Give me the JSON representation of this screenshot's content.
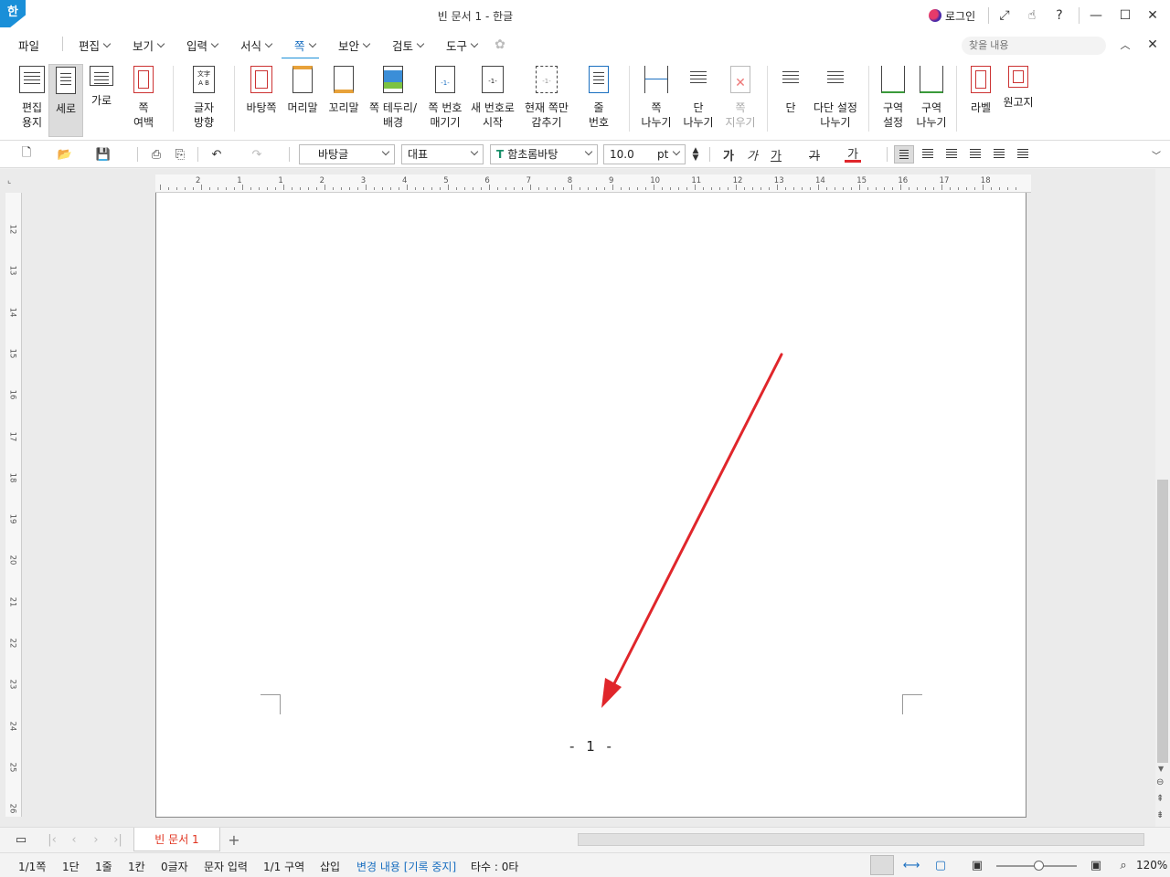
{
  "titlebar": {
    "app_logo": "한",
    "title": "빈 문서 1 - 한글",
    "login": "로그인"
  },
  "menu": {
    "file": "파일",
    "items": [
      "편집",
      "보기",
      "입력",
      "서식",
      "쪽",
      "보안",
      "검토",
      "도구"
    ],
    "active": "쪽",
    "search_placeholder": "찾을 내용"
  },
  "ribbon": {
    "buttons": [
      {
        "label": "편집\n용지"
      },
      {
        "label": "세로"
      },
      {
        "label": "가로"
      },
      {
        "label": "쪽\n여백"
      },
      {
        "label": "글자\n방향"
      },
      {
        "label": "바탕쪽"
      },
      {
        "label": "머리말"
      },
      {
        "label": "꼬리말"
      },
      {
        "label": "쪽 테두리/\n배경"
      },
      {
        "label": "쪽 번호\n매기기"
      },
      {
        "label": "새 번호로\n시작"
      },
      {
        "label": "현재 쪽만\n감추기"
      },
      {
        "label": "줄\n번호"
      },
      {
        "label": "쪽\n나누기"
      },
      {
        "label": "단\n나누기"
      },
      {
        "label": "쪽\n지우기"
      },
      {
        "label": "단"
      },
      {
        "label": "다단 설정\n나누기"
      },
      {
        "label": "구역\n설정"
      },
      {
        "label": "구역\n나누기"
      },
      {
        "label": "라벨"
      },
      {
        "label": "원고지"
      }
    ],
    "icon_text": {
      "page_num_icon": "-1-",
      "new_num_icon": "-1-",
      "hide_icon": "-1-",
      "new_num_small": "-3-",
      "hide_small": "-3-",
      "line_num_a": "1",
      "line_num_b": "2",
      "line_num_c": "3",
      "text_dir": "文字\nA B"
    }
  },
  "format": {
    "style": "바탕글",
    "lang": "대표",
    "font": "함초롬바탕",
    "font_icon": "T",
    "size": "10.0",
    "unit": "pt",
    "bold_glyph": "가",
    "italic_glyph": "가",
    "underline_glyph": "가",
    "strike_glyph": "가",
    "color_glyph": "가"
  },
  "ruler": {
    "h_numbers": [
      "2",
      "1",
      "1",
      "2",
      "3",
      "4",
      "5",
      "6",
      "7",
      "8",
      "9",
      "10",
      "11",
      "12",
      "13",
      "14",
      "15",
      "16",
      "17",
      "18"
    ],
    "v_numbers": [
      "12",
      "13",
      "14",
      "15",
      "16",
      "17",
      "18",
      "19",
      "20",
      "21",
      "22",
      "23",
      "24",
      "25",
      "26"
    ]
  },
  "page": {
    "page_number_text": "- 1 -",
    "annotation_color": "#e0262b"
  },
  "tabs": {
    "doc_tab": "빈 문서 1",
    "add_glyph": "+"
  },
  "status": {
    "page": "1/1쪽",
    "column": "1단",
    "line": "1줄",
    "cell": "1칸",
    "chars": "0글자",
    "input_mode": "문자 입력",
    "section": "1/1 구역",
    "insert": "삽입",
    "track": "변경 내용 [기록 중지]",
    "keystrokes": "타수 : 0타",
    "zoom": "120%"
  },
  "colors": {
    "accent": "#1a8fd8",
    "tab_text": "#e0321e"
  }
}
